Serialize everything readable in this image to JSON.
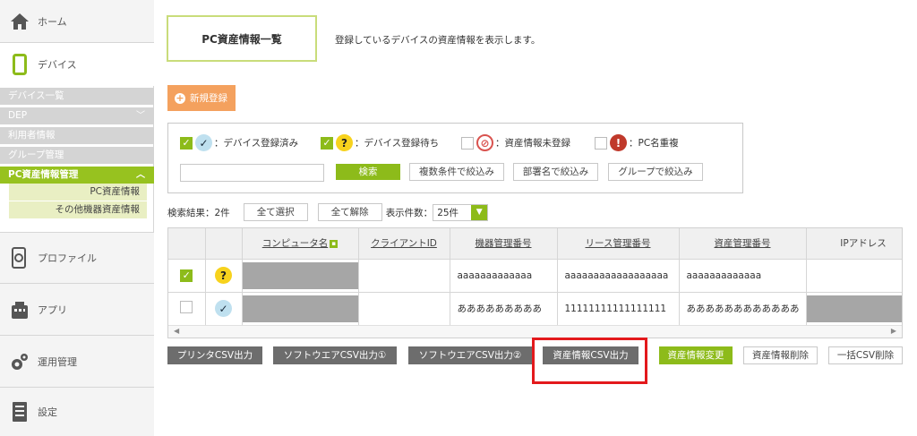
{
  "sidebar": {
    "home": "ホーム",
    "devices": "デバイス",
    "device_list": "デバイス一覧",
    "dep": "DEP",
    "user_info": "利用者情報",
    "group_mgmt": "グループ管理",
    "pc_assets": "PC資産情報管理",
    "pc_asset_info": "PC資産情報",
    "other_asset_info": "その他機器資産情報",
    "profile": "プロファイル",
    "apps": "アプリ",
    "operations": "運用管理",
    "settings": "設定"
  },
  "page": {
    "title": "PC資産情報一覧",
    "description": "登録しているデバイスの資産情報を表示します。",
    "new_button": "新規登録"
  },
  "filter": {
    "legend": [
      {
        "label": "：デバイス登録済み",
        "checked": true,
        "status": "registered"
      },
      {
        "label": "：デバイス登録待ち",
        "checked": true,
        "status": "waiting"
      },
      {
        "label": "：資産情報未登録",
        "checked": false,
        "status": "unregistered"
      },
      {
        "label": "：PC名重複",
        "checked": false,
        "status": "duplicate"
      }
    ],
    "search_value": "",
    "search_button": "検索",
    "multi_condition": "複数条件で絞込み",
    "dept_filter": "部署名で絞込み",
    "group_filter": "グループで絞込み"
  },
  "results": {
    "count_label": "検索結果：2件",
    "select_all": "全て選択",
    "deselect_all": "全て解除",
    "per_page_label": "表示件数：",
    "per_page_value": "25件"
  },
  "table": {
    "headers": [
      "",
      "",
      "コンピュータ名",
      "クライアントID",
      "機器管理番号",
      "リース管理番号",
      "資産管理番号",
      "IPアドレス"
    ],
    "rows": [
      {
        "checked": true,
        "status": "waiting",
        "computer": "",
        "client_id": "",
        "device_no": "aaaaaaaaaaaaa",
        "lease_no": "aaaaaaaaaaaaaaaaaa",
        "asset_no": "aaaaaaaaaaaaa",
        "ip": ""
      },
      {
        "checked": false,
        "status": "registered",
        "computer": "",
        "client_id": "",
        "device_no": "あああああああああ",
        "lease_no": "11111111111111111",
        "asset_no": "ああああああああああああ",
        "ip": ""
      }
    ]
  },
  "actions": {
    "printer_csv": "プリンタCSV出力",
    "software_csv1": "ソフトウエアCSV出力①",
    "software_csv2": "ソフトウエアCSV出力②",
    "asset_csv": "資産情報CSV出力",
    "asset_change": "資産情報変更",
    "asset_delete": "資産情報削除",
    "bulk_csv_delete": "一括CSV削除"
  },
  "colors": {
    "accent_green": "#8dbb1a",
    "orange": "#f4a15e",
    "highlight_red": "#e3191c"
  }
}
